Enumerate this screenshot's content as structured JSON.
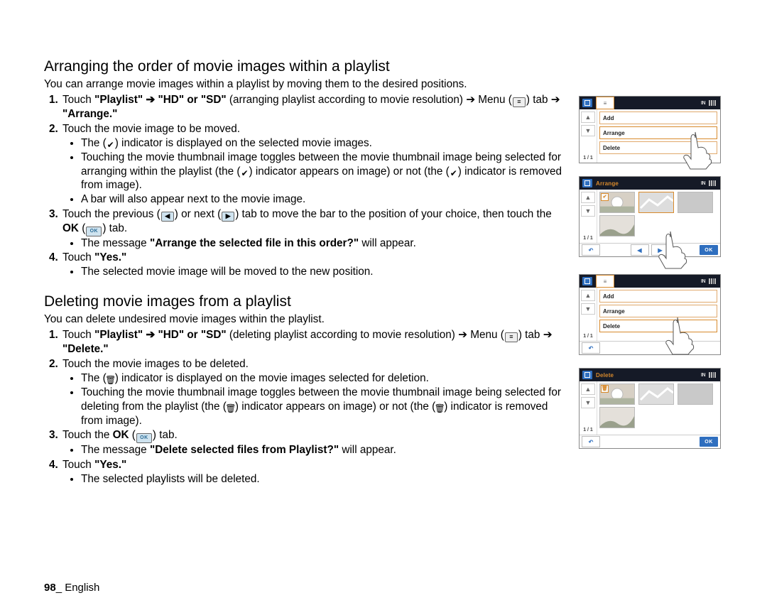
{
  "section1": {
    "heading": "Arranging the order of movie images within a playlist",
    "intro": "You can arrange movie images within a playlist by moving them to the desired positions.",
    "step1": {
      "prefix": "Touch ",
      "quoted1": "\"Playlist\"",
      "arrow1": " ➔ ",
      "quoted2": "\"HD\" or \"SD\"",
      "paren": " (arranging playlist according to movie resolution) ",
      "arrow2": "➔",
      "menu_word": " Menu (",
      "tabword": ") tab ",
      "arrow3": "➔",
      "quoted3": " \"Arrange.\""
    },
    "step2": "Touch the movie image to be moved.",
    "step2_b1_a": "The (",
    "step2_b1_b": ") indicator is displayed on the selected movie images.",
    "step2_b2_a": "Touching the movie thumbnail image toggles between the movie thumbnail image being selected for arranging within the playlist (the (",
    "step2_b2_b": ") indicator appears on image) or not (the (",
    "step2_b2_c": ") indicator is removed from image).",
    "step2_b3": "A bar will also appear next to the movie image.",
    "step3_a": "Touch the previous (",
    "step3_b": ") or next (",
    "step3_c": ") tab to move the bar to the position of your choice, then touch the ",
    "step3_ok": "OK",
    "step3_d": " (",
    "step3_e": ") tab.",
    "step3_b1_a": "The message ",
    "step3_b1_msg": "\"Arrange the selected file in this order?\"",
    "step3_b1_b": " will appear.",
    "step4_a": "Touch ",
    "step4_yes": "\"Yes.\"",
    "step4_b1": "The selected movie image will be moved to the new position."
  },
  "section2": {
    "heading": "Deleting movie images from a playlist",
    "intro": "You can delete undesired movie images within the playlist.",
    "step1": {
      "prefix": "Touch ",
      "quoted1": "\"Playlist\"",
      "arrow1": " ➔ ",
      "quoted2": "\"HD\" or \"SD\"",
      "paren": " (deleting playlist according to movie resolution) ",
      "arrow2": "➔",
      "menu_word": " Menu (",
      "tabword": ") tab ",
      "arrow3": "➔",
      "quoted3": " \"Delete.\""
    },
    "step2": "Touch the movie images to be deleted.",
    "step2_b1_a": "The (",
    "step2_b1_b": ") indicator is displayed on the movie images selected for deletion.",
    "step2_b2_a": "Touching the movie thumbnail image toggles between the movie thumbnail image being selected for deleting from the playlist (the (",
    "step2_b2_b": ") indicator appears on image) or not (the (",
    "step2_b2_c": ") indicator is removed from image).",
    "step3_a": "Touch the ",
    "step3_ok": "OK",
    "step3_b": " (",
    "step3_c": ") tab.",
    "step3_b1_a": "The message ",
    "step3_b1_msg": "\"Delete selected files from Playlist?\"",
    "step3_b1_b": " will appear.",
    "step4_a": "Touch ",
    "step4_yes": "\"Yes.\"",
    "step4_b1": "The selected playlists will be deleted."
  },
  "figures": {
    "f1": {
      "rows": [
        "Add",
        "Arrange",
        "Delete"
      ],
      "pager": "1 / 1",
      "in": "IN",
      "selected": "Arrange"
    },
    "f2": {
      "title": "Arrange",
      "pager": "1 / 1",
      "in": "IN",
      "ok": "OK"
    },
    "f3": {
      "rows": [
        "Add",
        "Arrange",
        "Delete"
      ],
      "pager": "1 / 1",
      "in": "IN",
      "selected": "Delete"
    },
    "f4": {
      "title": "Delete",
      "pager": "1 / 1",
      "in": "IN",
      "ok": "OK"
    }
  },
  "footer": {
    "page": "98",
    "sep": "_ ",
    "lang": "English"
  }
}
